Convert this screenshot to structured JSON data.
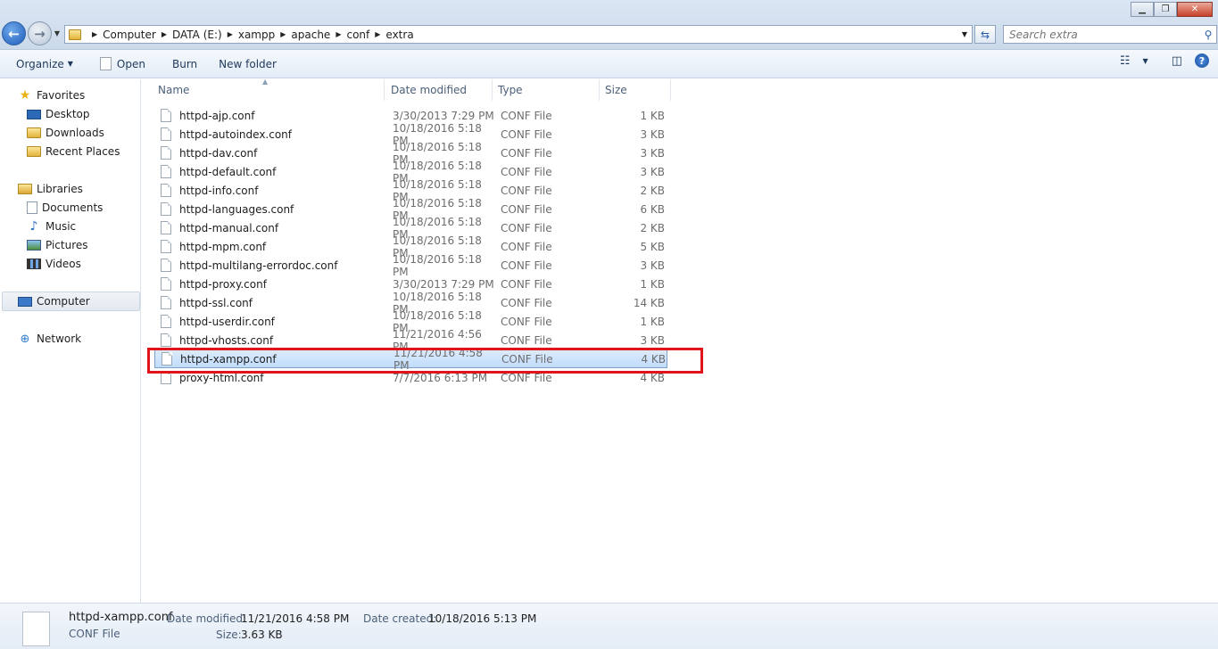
{
  "nav": {
    "breadcrumb": [
      "Computer",
      "DATA (E:)",
      "xampp",
      "apache",
      "conf",
      "extra"
    ],
    "search_placeholder": "Search extra"
  },
  "toolbar": {
    "organize": "Organize",
    "open": "Open",
    "burn": "Burn",
    "new_folder": "New folder"
  },
  "sidebar": {
    "favorites": "Favorites",
    "desktop": "Desktop",
    "downloads": "Downloads",
    "recent": "Recent Places",
    "libraries": "Libraries",
    "documents": "Documents",
    "music": "Music",
    "pictures": "Pictures",
    "videos": "Videos",
    "computer": "Computer",
    "network": "Network"
  },
  "columns": {
    "name": "Name",
    "date": "Date modified",
    "type": "Type",
    "size": "Size"
  },
  "files": [
    {
      "name": "httpd-ajp.conf",
      "date": "3/30/2013 7:29 PM",
      "type": "CONF File",
      "size": "1 KB"
    },
    {
      "name": "httpd-autoindex.conf",
      "date": "10/18/2016 5:18 PM",
      "type": "CONF File",
      "size": "3 KB"
    },
    {
      "name": "httpd-dav.conf",
      "date": "10/18/2016 5:18 PM",
      "type": "CONF File",
      "size": "3 KB"
    },
    {
      "name": "httpd-default.conf",
      "date": "10/18/2016 5:18 PM",
      "type": "CONF File",
      "size": "3 KB"
    },
    {
      "name": "httpd-info.conf",
      "date": "10/18/2016 5:18 PM",
      "type": "CONF File",
      "size": "2 KB"
    },
    {
      "name": "httpd-languages.conf",
      "date": "10/18/2016 5:18 PM",
      "type": "CONF File",
      "size": "6 KB"
    },
    {
      "name": "httpd-manual.conf",
      "date": "10/18/2016 5:18 PM",
      "type": "CONF File",
      "size": "2 KB"
    },
    {
      "name": "httpd-mpm.conf",
      "date": "10/18/2016 5:18 PM",
      "type": "CONF File",
      "size": "5 KB"
    },
    {
      "name": "httpd-multilang-errordoc.conf",
      "date": "10/18/2016 5:18 PM",
      "type": "CONF File",
      "size": "3 KB"
    },
    {
      "name": "httpd-proxy.conf",
      "date": "3/30/2013 7:29 PM",
      "type": "CONF File",
      "size": "1 KB"
    },
    {
      "name": "httpd-ssl.conf",
      "date": "10/18/2016 5:18 PM",
      "type": "CONF File",
      "size": "14 KB"
    },
    {
      "name": "httpd-userdir.conf",
      "date": "10/18/2016 5:18 PM",
      "type": "CONF File",
      "size": "1 KB"
    },
    {
      "name": "httpd-vhosts.conf",
      "date": "11/21/2016 4:56 PM",
      "type": "CONF File",
      "size": "3 KB"
    },
    {
      "name": "httpd-xampp.conf",
      "date": "11/21/2016 4:58 PM",
      "type": "CONF File",
      "size": "4 KB"
    },
    {
      "name": "proxy-html.conf",
      "date": "7/7/2016 6:13 PM",
      "type": "CONF File",
      "size": "4 KB"
    }
  ],
  "details": {
    "name": "httpd-xampp.conf",
    "type": "CONF File",
    "modified_label": "Date modified:",
    "modified_value": "11/21/2016 4:58 PM",
    "created_label": "Date created:",
    "created_value": "10/18/2016 5:13 PM",
    "size_label": "Size:",
    "size_value": "3.63 KB"
  },
  "colors": {
    "selection": "#c1dcfc",
    "highlight_box": "#e0141b"
  }
}
